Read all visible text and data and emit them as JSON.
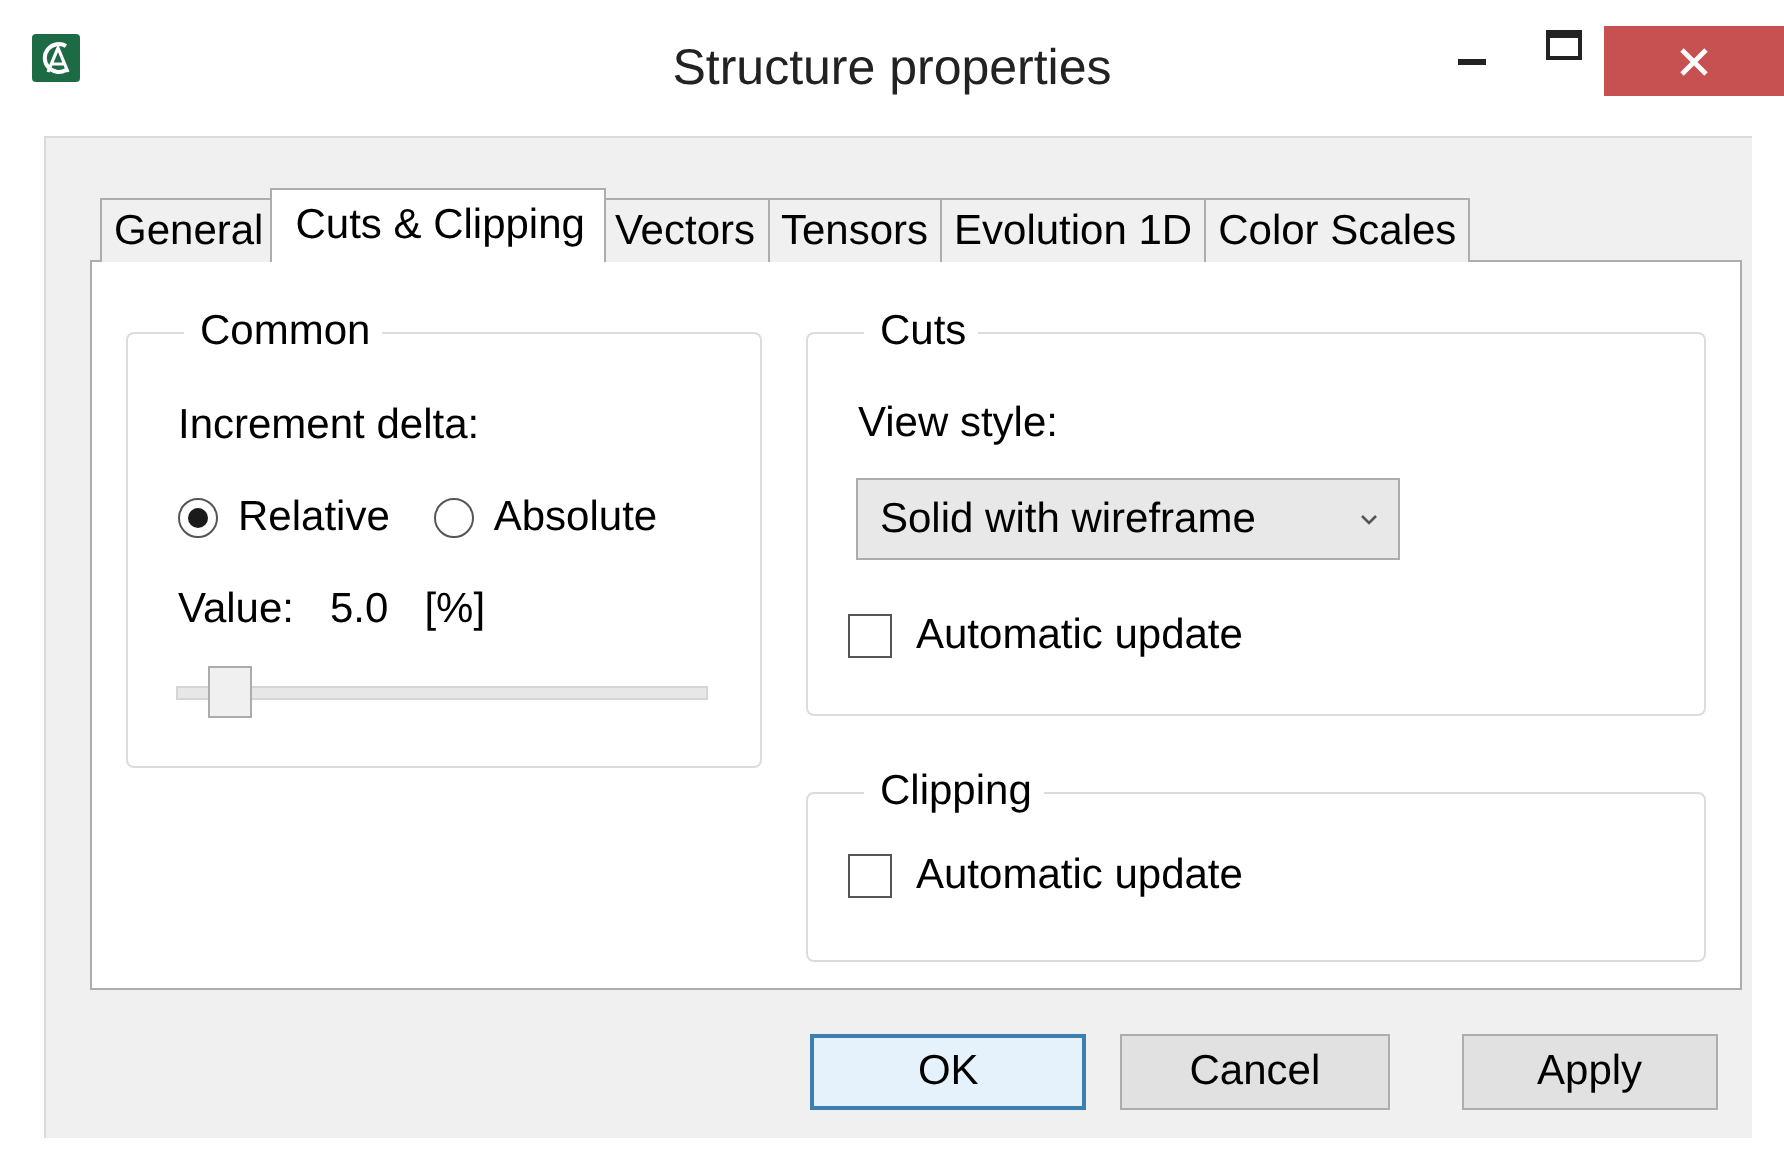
{
  "window": {
    "title": "Structure properties"
  },
  "tabs": [
    {
      "label": "General",
      "selected": false
    },
    {
      "label": "Cuts & Clipping",
      "selected": true
    },
    {
      "label": "Vectors",
      "selected": false
    },
    {
      "label": "Tensors",
      "selected": false
    },
    {
      "label": "Evolution 1D",
      "selected": false
    },
    {
      "label": "Color Scales",
      "selected": false
    }
  ],
  "common": {
    "title": "Common",
    "increment_label": "Increment delta:",
    "modes": [
      {
        "label": "Relative",
        "selected": true
      },
      {
        "label": "Absolute",
        "selected": false
      }
    ],
    "value_label": "Value:",
    "value": "5.0",
    "unit": "[%]",
    "slider": {
      "level": 0.05
    }
  },
  "cuts": {
    "title": "Cuts",
    "view_style_label": "View style:",
    "view_style": "Solid with wireframe",
    "automatic_update": {
      "label": "Automatic update",
      "checked": false
    }
  },
  "clipping": {
    "title": "Clipping",
    "automatic_update": {
      "label": "Automatic update",
      "checked": false
    }
  },
  "buttons": [
    {
      "label": "OK",
      "default": true
    },
    {
      "label": "Cancel",
      "default": false
    },
    {
      "label": "Apply",
      "default": false
    }
  ]
}
